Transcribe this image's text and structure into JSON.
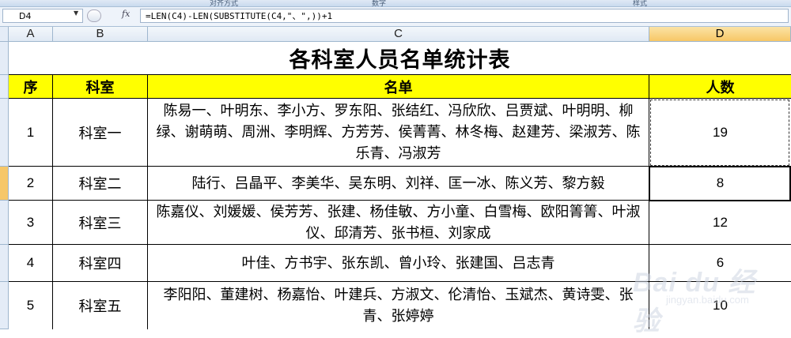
{
  "ribbon": {
    "labels": [
      "对齐方式",
      "数字",
      "样式"
    ]
  },
  "formula_bar": {
    "name_box": "D4",
    "fx_label": "fx",
    "formula": "=LEN(C4)-LEN(SUBSTITUTE(C4,\"、\",))+1"
  },
  "columns": [
    "A",
    "B",
    "C",
    "D"
  ],
  "sheet": {
    "title": "各科室人员名单统计表",
    "headers": {
      "seq": "序",
      "dept": "科室",
      "names": "名单",
      "count": "人数"
    },
    "rows": [
      {
        "seq": "1",
        "dept": "科室一",
        "names": "陈易一、叶明东、李小方、罗东阳、张结红、冯欣欣、吕贾斌、叶明明、柳绿、谢萌萌、周洲、李明辉、方芳芳、侯菁菁、林冬梅、赵建芳、梁淑芳、陈乐青、冯淑芳",
        "count": "19"
      },
      {
        "seq": "2",
        "dept": "科室二",
        "names": "陆行、吕晶平、李美华、吴东明、刘祥、匡一冰、陈义芳、黎方毅",
        "count": "8"
      },
      {
        "seq": "3",
        "dept": "科室三",
        "names": "陈嘉仪、刘媛媛、侯芳芳、张建、杨佳敏、方小童、白雪梅、欧阳箐箐、叶淑仪、邱清芳、张书桓、刘家成",
        "count": "12"
      },
      {
        "seq": "4",
        "dept": "科室四",
        "names": "叶佳、方书宇、张东凯、曾小玲、张建国、吕志青",
        "count": "6"
      },
      {
        "seq": "5",
        "dept": "科室五",
        "names": "李阳阳、董建树、杨嘉怡、叶建兵、方淑文、伦清怡、玉斌杰、黄诗雯、张青、张婷婷",
        "count": "10"
      }
    ]
  },
  "watermark": {
    "brand": "Bai du 经验",
    "url": "jingyan.baidu.com"
  },
  "colors": {
    "header_fill": "#ffff00",
    "selected_header": "#f7c766",
    "grid_line": "#000000"
  }
}
